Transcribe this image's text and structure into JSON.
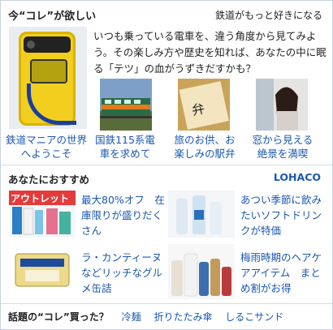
{
  "section1": {
    "title": "今“コレ”が欲しい",
    "sublink": "鉄道がもっと好きになる",
    "lead": "いつも乗っている電車を、違う角度から見てみよう。その楽しみ方や歴史を知れば、あなたの中に眠る「テツ」の血がうずきだすかも？",
    "hero_caption": "鉄道マニアの世界へようこそ",
    "items": [
      {
        "caption": "国鉄115系電車を求めて"
      },
      {
        "caption": "旅のお供、お楽しみの駅弁"
      },
      {
        "caption": "窓から見える絶景を満喫"
      }
    ]
  },
  "section2": {
    "title": "あなたにおすすめ",
    "brand": "LOHACO",
    "items": [
      {
        "text": "最大80%オフ　在庫限りが盛りだくさん",
        "img_label": "アウトレット"
      },
      {
        "text": "あつい季節に飲みたいソフトドリンクが特価"
      },
      {
        "text": "ラ・カンティーヌなどリッチなグルメ缶詰"
      },
      {
        "text": "梅雨時期のヘアケアアイテム　まとめ割がお得"
      }
    ]
  },
  "bottom": {
    "label": "話題の“コレ”買った？",
    "links": [
      "冷麺",
      "折りたたみ傘",
      "しるこサンド"
    ]
  }
}
